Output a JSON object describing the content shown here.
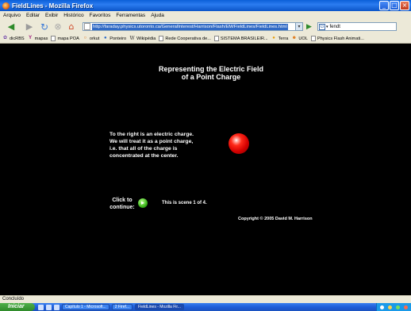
{
  "window": {
    "title": "FieldLines - Mozilla Firefox",
    "controls": {
      "minimize": "_",
      "maximize": "□",
      "close": "×"
    }
  },
  "menu": [
    "Arquivo",
    "Editar",
    "Exibir",
    "Histórico",
    "Favoritos",
    "Ferramentas",
    "Ajuda"
  ],
  "nav": {
    "url": "http://faraday.physics.utoronto.ca/GeneralInterest/Harrison/Flash/EM/FieldLines/FieldLines.html",
    "search_value": "fendt"
  },
  "bookmarks": [
    {
      "label": "dicRBS",
      "icon": "flower-icon"
    },
    {
      "label": "mapas",
      "icon": "yahoo-icon"
    },
    {
      "label": "mapa POA",
      "icon": "page-icon"
    },
    {
      "label": "orkut",
      "icon": "orkut-icon"
    },
    {
      "label": "Ponteiro",
      "icon": "globe-icon"
    },
    {
      "label": "Wikipédia",
      "icon": "wikipedia-icon"
    },
    {
      "label": "Rede Cooperativa de...",
      "icon": "page-icon"
    },
    {
      "label": "SISTEMA BRASILEIR...",
      "icon": "page-icon"
    },
    {
      "label": "Terra",
      "icon": "terra-icon"
    },
    {
      "label": "UOL",
      "icon": "uol-icon"
    },
    {
      "label": "Physics Flash Animati...",
      "icon": "page-icon"
    }
  ],
  "content": {
    "headline_line1": "Representing the Electric Field",
    "headline_line2": "of a Point Charge",
    "intro_line1": "To the right is an electric charge.",
    "intro_line2": "We will treat it as a point charge,",
    "intro_line3": "i.e. that all of the charge is",
    "intro_line4": "concentrated at the center.",
    "continue_line1": "Click to",
    "continue_line2": "continue:",
    "scene": "This is scene 1 of 4.",
    "copyright": "Copyright © 2005 David M. Harrison"
  },
  "status": "Concluído",
  "taskbar": {
    "start": "Iniciar",
    "tasks": [
      "Capítulo 1 - Microsoft...",
      "2 Firef...",
      "FieldLines - Mozilla Fir..."
    ]
  }
}
